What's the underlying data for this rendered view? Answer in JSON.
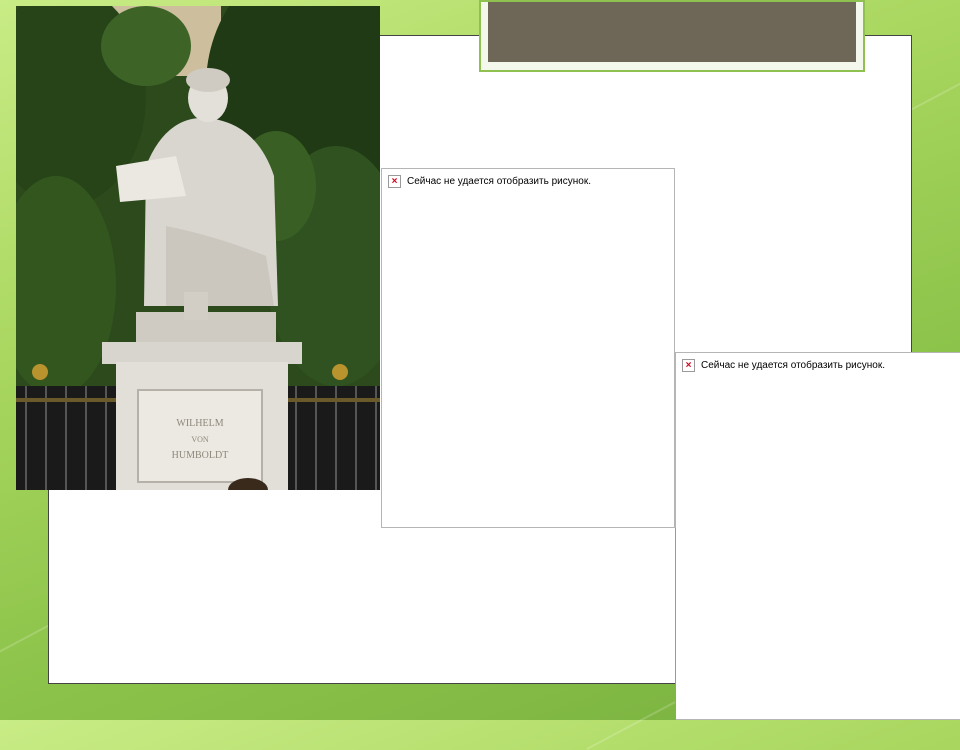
{
  "slide": {
    "title_text": "",
    "colors": {
      "background_green": "#a8d65e",
      "title_bar_fill": "#6e6757",
      "title_bar_border": "#8fc150",
      "panel_fill": "#ffffff"
    }
  },
  "photo": {
    "subject": "statue-photo",
    "inscription_lines": [
      "WILHELM",
      "VON",
      "HUMBOLDT"
    ]
  },
  "placeholders": [
    {
      "message": "Сейчас не удается отобразить рисунок.",
      "icon": "broken-image-x-icon"
    },
    {
      "message": "Сейчас не удается отобразить рисунок.",
      "icon": "broken-image-x-icon"
    }
  ]
}
